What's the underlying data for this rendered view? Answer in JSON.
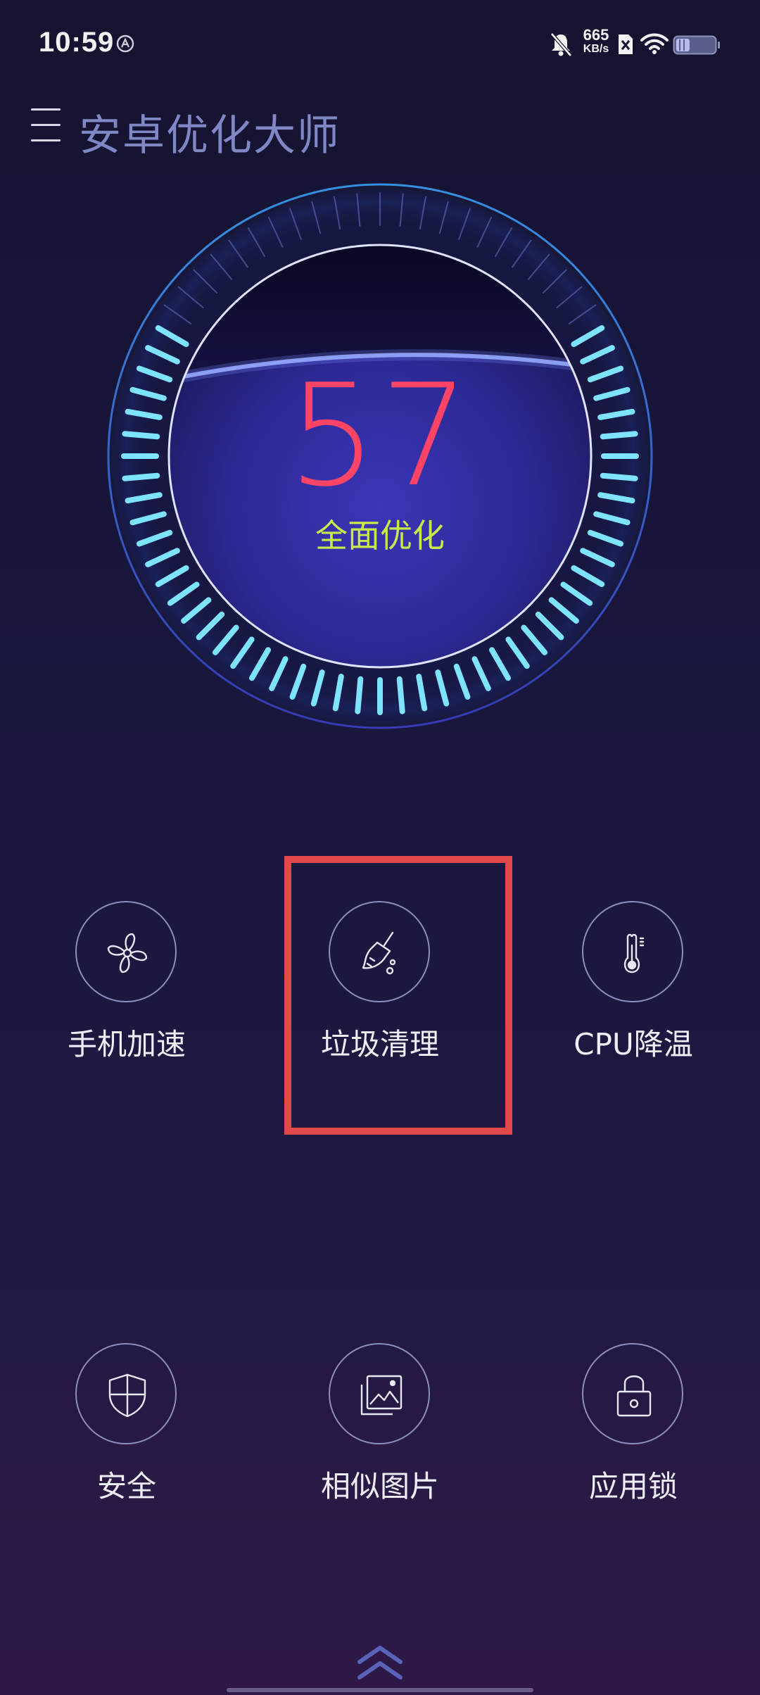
{
  "status_bar": {
    "time": "10:59",
    "net_speed_value": "665",
    "net_speed_unit": "KB/s",
    "icons": [
      "app-notification-icon",
      "mute-bell-icon",
      "sim-off-icon",
      "wifi-icon",
      "battery-icon"
    ],
    "battery_level": 0.35
  },
  "header": {
    "menu_icon": "hamburger-menu-icon",
    "title": "安卓优化大师"
  },
  "gauge": {
    "score": "57",
    "action_label": "全面优化",
    "score_color": "#ff4466",
    "action_color": "#c7ea4a",
    "tick_color": "#7ee3ff"
  },
  "features": [
    {
      "id": "phone-boost",
      "label": "手机加速",
      "icon": "fan-icon"
    },
    {
      "id": "junk-clean",
      "label": "垃圾清理",
      "icon": "broom-icon"
    },
    {
      "id": "cpu-cool",
      "label": "CPU降温",
      "icon": "thermometer-icon"
    },
    {
      "id": "security",
      "label": "安全",
      "icon": "shield-icon"
    },
    {
      "id": "similar-photos",
      "label": "相似图片",
      "icon": "photos-icon"
    },
    {
      "id": "app-lock",
      "label": "应用锁",
      "icon": "lock-icon"
    }
  ],
  "highlight": {
    "target": "垃圾清理",
    "color": "#e2484a"
  },
  "bottom": {
    "expand_icon": "double-chevron-up-icon"
  }
}
